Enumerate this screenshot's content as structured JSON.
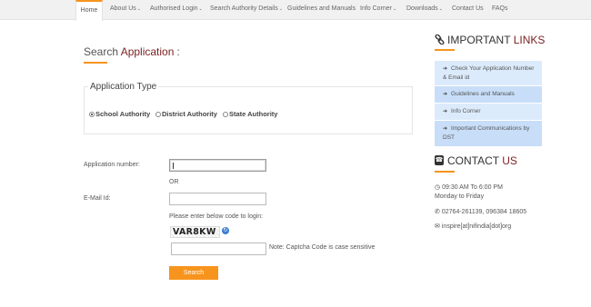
{
  "nav": {
    "items": [
      {
        "label": "Home",
        "dropdown": false,
        "active": true
      },
      {
        "label": "About Us",
        "dropdown": true
      },
      {
        "label": "Authorised Login",
        "dropdown": true
      },
      {
        "label": "Search Authority Details",
        "dropdown": true
      },
      {
        "label": "Guidelines and Manuals",
        "dropdown": false
      },
      {
        "label": "Info Corner",
        "dropdown": true
      },
      {
        "label": "Downloads",
        "dropdown": true
      },
      {
        "label": "Contact Us",
        "dropdown": false
      },
      {
        "label": "FAQs",
        "dropdown": false
      }
    ],
    "caret": "⌄"
  },
  "search": {
    "title_prefix": "Search",
    "title_accent": "Application",
    "title_suffix": ":"
  },
  "application_type": {
    "legend": "Application Type",
    "options": [
      {
        "label": "School Authority",
        "checked": true
      },
      {
        "label": "District Authority",
        "checked": false
      },
      {
        "label": "State Authority",
        "checked": false
      }
    ]
  },
  "form": {
    "application_number_label": "Application number:",
    "application_number_value": "",
    "or_text": "OR",
    "email_label": "E-Mail Id:",
    "email_value": "",
    "captcha_prompt": "Please enter below code to login:",
    "captcha_code": "VAR8KW",
    "captcha_refresh_icon": "refresh-icon",
    "captcha_value": "",
    "captcha_note": "Note: Captcha Code is case sensitive",
    "search_button": "Search"
  },
  "important_links": {
    "heading_prefix": "IMPORTANT",
    "heading_accent": "LINKS",
    "icon": "link-icon",
    "items": [
      {
        "label": "Check Your Application Number & Email id"
      },
      {
        "label": "Guidelines and Manuals"
      },
      {
        "label": "Info Corner"
      },
      {
        "label": "Important Communications by DST"
      }
    ]
  },
  "contact": {
    "heading_prefix": "CONTACT",
    "heading_accent": "US",
    "icon": "phone-icon",
    "hours": "09:30 AM To 6:00 PM",
    "days": "Monday to Friday",
    "phone": "02764-261139, 096384 18605",
    "email": "inspire[at]nifindia[dot]org"
  },
  "colors": {
    "accent": "#f7941d",
    "title_accent": "#7a1f1f",
    "link_bg": "#dcebfb",
    "nav_bg": "#f1f1f1"
  }
}
